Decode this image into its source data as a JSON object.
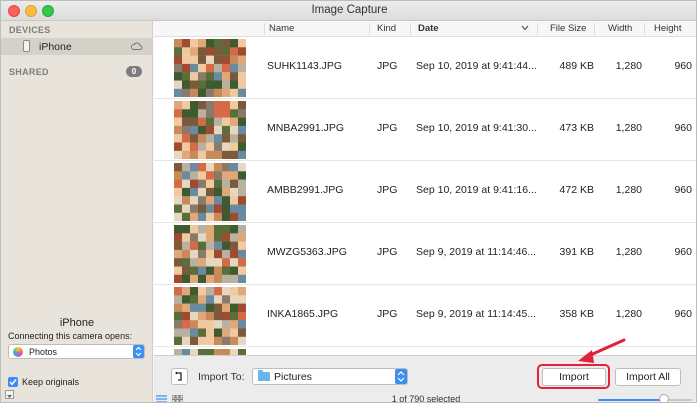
{
  "window": {
    "title": "Image Capture"
  },
  "sidebar": {
    "devices_heading": "DEVICES",
    "device": {
      "label": "iPhone"
    },
    "shared_heading": "SHARED",
    "shared_count": "0",
    "device_name": "iPhone",
    "connecting_label": "Connecting this camera opens:",
    "open_with": "Photos",
    "keep_originals_label": "Keep originals",
    "keep_originals_checked": true
  },
  "table": {
    "columns": {
      "name": "Name",
      "kind": "Kind",
      "date": "Date",
      "file_size": "File Size",
      "width": "Width",
      "height": "Height"
    },
    "rows": [
      {
        "name": "SUHK1143.JPG",
        "kind": "JPG",
        "date": "Sep 10, 2019 at 9:41:44...",
        "size": "489 KB",
        "width": "1,280",
        "height": "960"
      },
      {
        "name": "MNBA2991.JPG",
        "kind": "JPG",
        "date": "Sep 10, 2019 at 9:41:30...",
        "size": "473 KB",
        "width": "1,280",
        "height": "960"
      },
      {
        "name": "AMBB2991.JPG",
        "kind": "JPG",
        "date": "Sep 10, 2019 at 9:41:16...",
        "size": "472 KB",
        "width": "1,280",
        "height": "960"
      },
      {
        "name": "MWZG5363.JPG",
        "kind": "JPG",
        "date": "Sep 9, 2019 at 11:14:46...",
        "size": "391 KB",
        "width": "1,280",
        "height": "960"
      },
      {
        "name": "INKA1865.JPG",
        "kind": "JPG",
        "date": "Sep 9, 2019 at 11:14:45...",
        "size": "358 KB",
        "width": "1,280",
        "height": "960"
      }
    ]
  },
  "bottom": {
    "import_to_label": "Import To:",
    "destination": "Pictures",
    "import_label": "Import",
    "import_all_label": "Import All",
    "status": "1 of 790 selected",
    "thumbnail_size_fraction": 0.7
  },
  "colors": {
    "accent": "#3c8ef3",
    "highlight": "#e2213b",
    "sidebar_bg": "#e8e4dc"
  }
}
